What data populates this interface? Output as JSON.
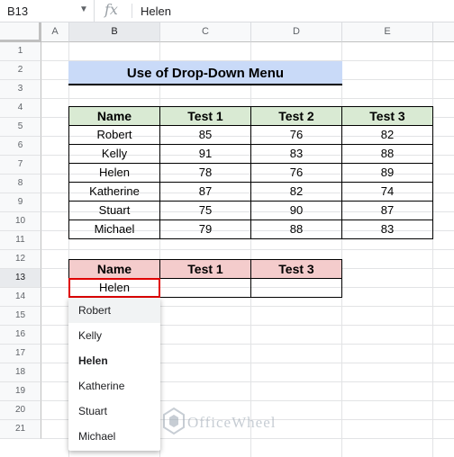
{
  "formula_bar": {
    "cell_ref": "B13",
    "fx_symbol": "fx",
    "value": "Helen"
  },
  "columns": [
    "A",
    "B",
    "C",
    "D",
    "E"
  ],
  "rows": [
    "1",
    "2",
    "3",
    "4",
    "5",
    "6",
    "7",
    "8",
    "9",
    "10",
    "11",
    "12",
    "13",
    "14",
    "15",
    "16",
    "17",
    "18",
    "19",
    "20",
    "21"
  ],
  "title": "Use of Drop-Down Menu",
  "table1": {
    "headers": [
      "Name",
      "Test 1",
      "Test 2",
      "Test 3"
    ],
    "rows": [
      [
        "Robert",
        "85",
        "76",
        "82"
      ],
      [
        "Kelly",
        "91",
        "83",
        "88"
      ],
      [
        "Helen",
        "78",
        "76",
        "89"
      ],
      [
        "Katherine",
        "87",
        "82",
        "74"
      ],
      [
        "Stuart",
        "75",
        "90",
        "87"
      ],
      [
        "Michael",
        "79",
        "88",
        "83"
      ]
    ]
  },
  "table2": {
    "headers": [
      "Name",
      "Test 1",
      "Test 3"
    ],
    "row": [
      "Helen",
      "",
      ""
    ]
  },
  "dropdown": {
    "options": [
      "Robert",
      "Kelly",
      "Helen",
      "Katherine",
      "Stuart",
      "Michael"
    ],
    "hovered": "Robert",
    "selected": "Helen"
  },
  "watermark": "OfficeWheel",
  "colors": {
    "title_bg": "#c9daf8",
    "header1_bg": "#d9ead3",
    "header2_bg": "#f4cccc",
    "selection_border": "#e00000"
  }
}
